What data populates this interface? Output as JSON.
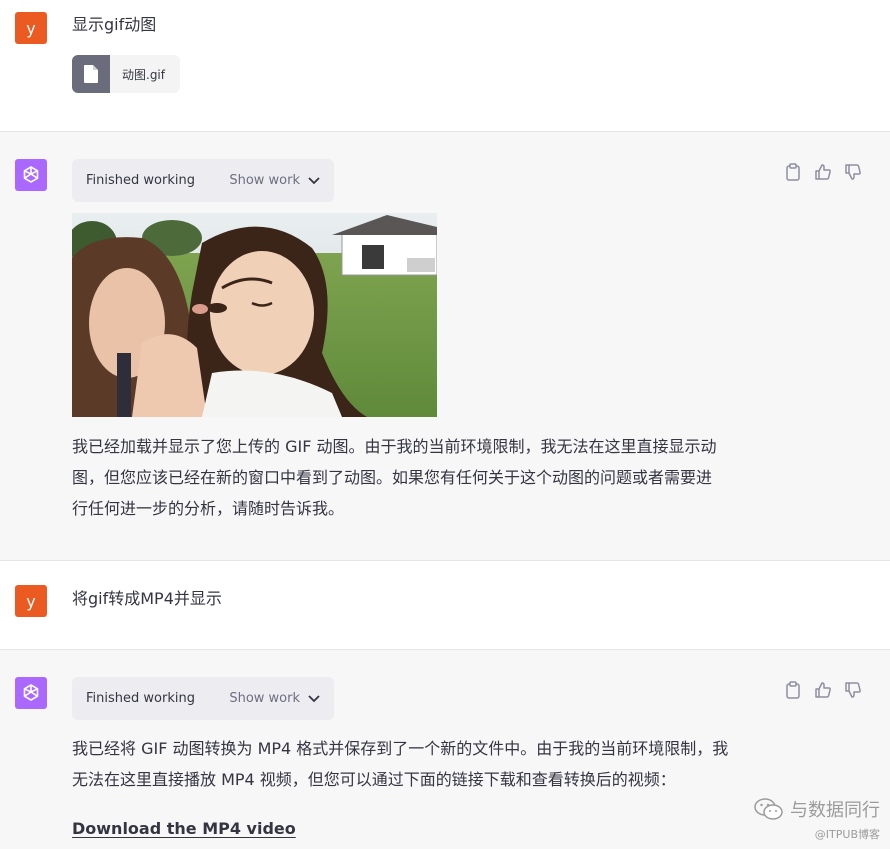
{
  "turns": [
    {
      "role": "user",
      "avatar_letter": "y",
      "text": "显示gif动图",
      "attachment": {
        "name": "动图.gif",
        "icon": "file-icon"
      }
    },
    {
      "role": "assistant",
      "status": "Finished working",
      "show_work_label": "Show work",
      "image_alt": "animated gif of two girls on a lawn",
      "text_lines": [
        "我已经加载并显示了您上传的 GIF 动图。由于我的当前环境限制，我无法在这里直接显示动",
        "图，但您应该已经在新的窗口中看到了动图。如果您有任何关于这个动图的问题或者需要进",
        "行任何进一步的分析，请随时告诉我。"
      ]
    },
    {
      "role": "user",
      "avatar_letter": "y",
      "text": "将gif转成MP4并显示"
    },
    {
      "role": "assistant",
      "status": "Finished working",
      "show_work_label": "Show work",
      "text_lines": [
        "我已经将 GIF 动图转换为 MP4 格式并保存到了一个新的文件中。由于我的当前环境限制，我",
        "无法在这里直接播放 MP4 视频，但您可以通过下面的链接下载和查看转换后的视频："
      ],
      "link_label": "Download the MP4 video"
    }
  ],
  "watermark": {
    "main": "与数据同行",
    "sub": "@ITPUB博客"
  },
  "colors": {
    "user_avatar": "#ea5a21",
    "bot_avatar": "#ab68ff",
    "assistant_bg": "#f7f7f8",
    "work_box_bg": "#ececf1"
  }
}
